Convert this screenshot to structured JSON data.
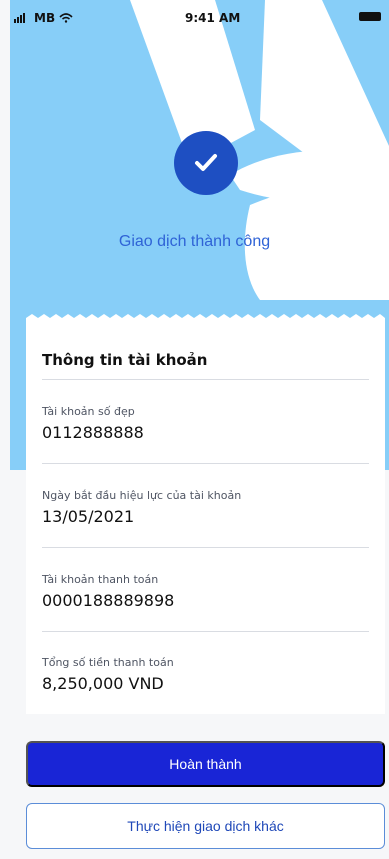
{
  "status_bar": {
    "carrier": "MB",
    "time": "9:41 AM"
  },
  "success": {
    "message": "Giao dịch thành công"
  },
  "account_info": {
    "title": "Thông tin tài khoản",
    "fields": [
      {
        "label": "Tài khoản số đẹp",
        "value": "0112888888"
      },
      {
        "label": "Ngày bắt đầu hiệu lực của tài khoản",
        "value": "13/05/2021"
      },
      {
        "label": "Tài khoản thanh toán",
        "value": "0000188889898"
      },
      {
        "label": "Tổng số tiền thanh toán",
        "value": "8,250,000 VND"
      }
    ]
  },
  "actions": {
    "primary_label": "Hoàn thành",
    "secondary_label": "Thực hiện giao dịch khác"
  },
  "colors": {
    "hero_bg": "#87cef8",
    "success_circle": "#1e4fc2",
    "primary_button": "#1925d6",
    "secondary_border": "#5b8dd8"
  },
  "icons": {
    "signal": "signal-icon",
    "wifi": "wifi-icon",
    "battery": "battery-icon",
    "success": "check-icon"
  }
}
